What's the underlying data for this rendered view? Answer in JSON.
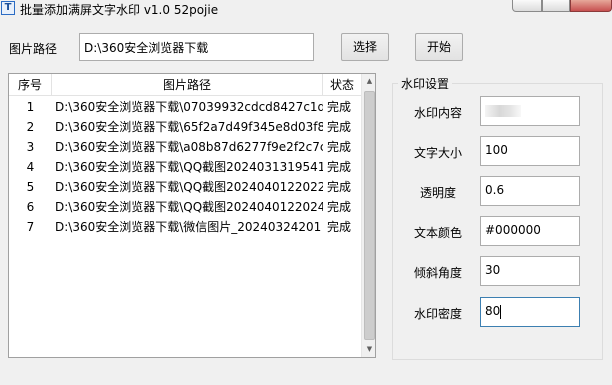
{
  "window": {
    "icon_text": "T",
    "title": "批量添加满屏文字水印 v1.0   52pojie"
  },
  "path_label": "图片路径",
  "path_value": "D:\\360安全浏览器下载",
  "buttons": {
    "select": "选择",
    "start": "开始"
  },
  "file_list": {
    "columns": [
      "序号",
      "图片路径",
      "状态"
    ],
    "rows": [
      {
        "num": "1",
        "path": "D:\\360安全浏览器下载\\07039932cdcd8427c1d",
        "status": "完成"
      },
      {
        "num": "2",
        "path": "D:\\360安全浏览器下载\\65f2a7d49f345e8d03f8",
        "status": "完成"
      },
      {
        "num": "3",
        "path": "D:\\360安全浏览器下载\\a08b87d6277f9e2f2c7c",
        "status": "完成"
      },
      {
        "num": "4",
        "path": "D:\\360安全浏览器下载\\QQ截图2024031319541",
        "status": "完成"
      },
      {
        "num": "5",
        "path": "D:\\360安全浏览器下载\\QQ截图2024040122022",
        "status": "完成"
      },
      {
        "num": "6",
        "path": "D:\\360安全浏览器下载\\QQ截图2024040122024",
        "status": "完成"
      },
      {
        "num": "7",
        "path": "D:\\360安全浏览器下载\\微信图片_20240324201",
        "status": "完成"
      }
    ]
  },
  "watermark_settings": {
    "title": "水印设置",
    "fields": {
      "content": {
        "label": "水印内容",
        "value": ""
      },
      "font_size": {
        "label": "文字大小",
        "value": "100"
      },
      "opacity": {
        "label": "透明度",
        "value": "0.6"
      },
      "color": {
        "label": "文本颜色",
        "value": "#000000"
      },
      "angle": {
        "label": "倾斜角度",
        "value": "30"
      },
      "density": {
        "label": "水印密度",
        "value": "80"
      }
    }
  }
}
